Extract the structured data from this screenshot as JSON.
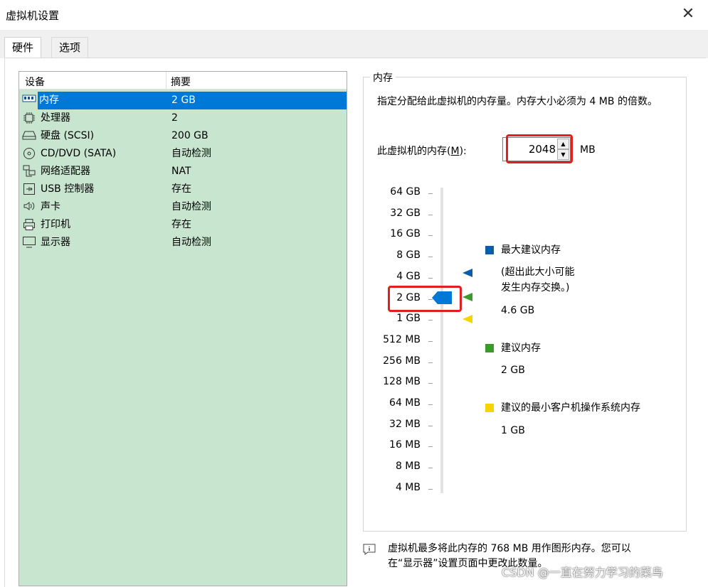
{
  "window": {
    "title": "虚拟机设置",
    "close": "✕"
  },
  "tabs": [
    {
      "label": "硬件"
    },
    {
      "label": "选项"
    }
  ],
  "devices": {
    "col_device": "设备",
    "col_summary": "摘要",
    "items": [
      {
        "name": "内存",
        "summary": "2 GB",
        "icon": "memory-icon"
      },
      {
        "name": "处理器",
        "summary": "2",
        "icon": "processor-icon"
      },
      {
        "name": "硬盘 (SCSI)",
        "summary": "200 GB",
        "icon": "harddisk-icon"
      },
      {
        "name": "CD/DVD (SATA)",
        "summary": "自动检测",
        "icon": "cd-icon"
      },
      {
        "name": "网络适配器",
        "summary": "NAT",
        "icon": "network-icon"
      },
      {
        "name": "USB 控制器",
        "summary": "存在",
        "icon": "usb-icon"
      },
      {
        "name": "声卡",
        "summary": "自动检测",
        "icon": "sound-icon"
      },
      {
        "name": "打印机",
        "summary": "存在",
        "icon": "printer-icon"
      },
      {
        "name": "显示器",
        "summary": "自动检测",
        "icon": "display-icon"
      }
    ]
  },
  "memory": {
    "group_title": "内存",
    "description": "指定分配给此虚拟机的内存量。内存大小必须为 4 MB 的倍数。",
    "label_prefix": "此虚拟机的内存(",
    "label_mnemonic": "M",
    "label_suffix": "):",
    "value": "2048",
    "unit": "MB",
    "scale": [
      "64 GB",
      "32 GB",
      "16 GB",
      "8 GB",
      "4 GB",
      "2 GB",
      "1 GB",
      "512 MB",
      "256 MB",
      "128 MB",
      "64 MB",
      "32 MB",
      "16 MB",
      "8 MB",
      "4 MB"
    ],
    "legend_max": {
      "title": "最大建议内存",
      "note_line1": "(超出此大小可能",
      "note_line2": "发生内存交换。)",
      "value": "4.6 GB",
      "color": "#0b5cad"
    },
    "legend_rec": {
      "title": "建议内存",
      "value": "2 GB",
      "color": "#3a9a2a"
    },
    "legend_min": {
      "title": "建议的最小客户机操作系统内存",
      "value": "1 GB",
      "color": "#f5d400"
    }
  },
  "footer": {
    "line1": "虚拟机最多将此内存的 768 MB 用作图形内存。您可以",
    "line2": "在“显示器”设置页面中更改此数量。"
  },
  "watermark": "CSDN @一直在努力学习的菜鸟"
}
